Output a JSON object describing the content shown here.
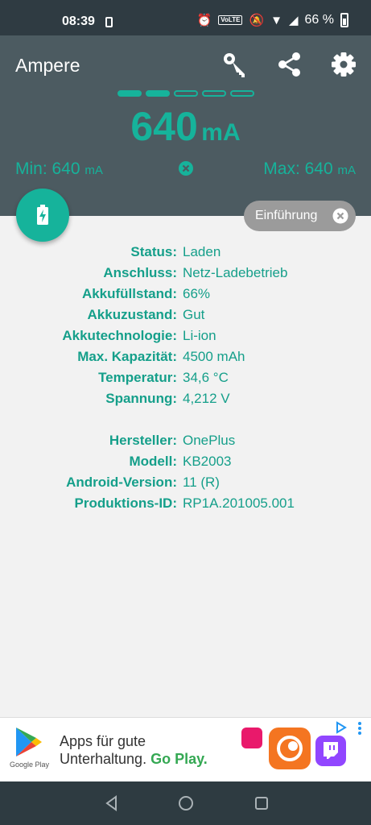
{
  "statusbar": {
    "time": "08:39",
    "network": "VoLTE",
    "battery_text": "66 %"
  },
  "app": {
    "title": "Ampere",
    "toolbar_icons": [
      "key-icon",
      "share-icon",
      "gear-icon"
    ]
  },
  "meter": {
    "value": "640",
    "unit": "mA",
    "min_label": "Min: 640",
    "max_label": "Max: 640",
    "min_unit": "mA",
    "max_unit": "mA",
    "level_of_5": 2,
    "accent": "#16b39b"
  },
  "chip": {
    "label": "Einführung"
  },
  "battery_info": [
    {
      "key": "Status:",
      "value": "Laden"
    },
    {
      "key": "Anschluss:",
      "value": "Netz-Ladebetrieb"
    },
    {
      "key": "Akkufüllstand:",
      "value": "66%"
    },
    {
      "key": "Akkuzustand:",
      "value": "Gut"
    },
    {
      "key": "Akkutechnologie:",
      "value": "Li-ion"
    },
    {
      "key": "Max. Kapazität:",
      "value": "4500 mAh"
    },
    {
      "key": "Temperatur:",
      "value": "34,6 °C"
    },
    {
      "key": "Spannung:",
      "value": "4,212 V"
    }
  ],
  "device_info": [
    {
      "key": "Hersteller:",
      "value": "OnePlus"
    },
    {
      "key": "Modell:",
      "value": "KB2003"
    },
    {
      "key": "Android-Version:",
      "value": "11 (R)"
    },
    {
      "key": "Produktions-ID:",
      "value": "RP1A.201005.001"
    }
  ],
  "ad": {
    "store_label": "Google Play",
    "line1": "Apps für gute",
    "line2_pre": "Unterhaltung.",
    "line2_hl": "Go Play."
  },
  "colors": {
    "header_bg": "#4c5b61",
    "statusbar_bg": "#2f3b42",
    "body_bg": "#f2f2f2"
  }
}
